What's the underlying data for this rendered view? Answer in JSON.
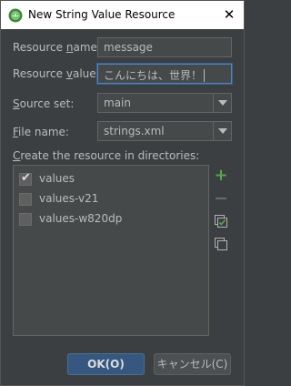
{
  "window": {
    "title": "New String Value Resource",
    "close_glyph": "✕"
  },
  "form": {
    "resource_name": {
      "label_pre": "Resource ",
      "label_ul": "n",
      "label_post": "ame:",
      "value": "message"
    },
    "resource_value": {
      "label_pre": "Resource ",
      "label_ul": "v",
      "label_post": "alue:",
      "value": "こんにちは、世界！"
    },
    "source_set": {
      "label_ul": "S",
      "label_post": "ource set:",
      "value": "main"
    },
    "file_name": {
      "label_ul": "F",
      "label_post": "ile name:",
      "value": "strings.xml"
    }
  },
  "directories": {
    "label_ul": "C",
    "label_post": "reate the resource in directories:",
    "items": [
      {
        "label": "values",
        "checked": true
      },
      {
        "label": "values-v21",
        "checked": false
      },
      {
        "label": "values-w820dp",
        "checked": false
      }
    ]
  },
  "buttons": {
    "ok": "OK(O)",
    "cancel": "キャンセル(C)"
  },
  "icons": {
    "app": "android-studio-icon",
    "add": "plus-icon",
    "remove": "minus-icon",
    "select_all": "select-all-icon",
    "copy": "copy-icon"
  },
  "colors": {
    "background": "#3c3f41",
    "field": "#45494a",
    "accent": "#365880",
    "add_green": "#57a64a"
  }
}
